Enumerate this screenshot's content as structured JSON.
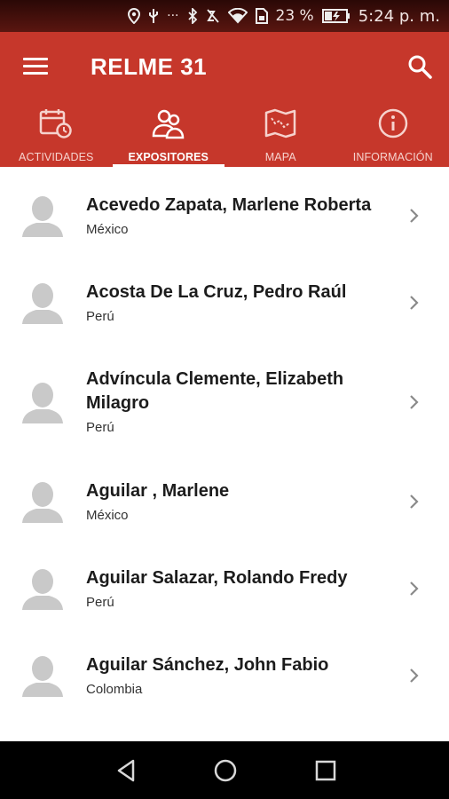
{
  "status_bar": {
    "icons": [
      "location-icon",
      "usb-icon",
      "more-icon",
      "bluetooth-icon",
      "mute-icon",
      "wifi-icon",
      "sim-icon",
      "battery-icon"
    ],
    "ellipsis": "···",
    "battery_percent": "23 %",
    "time": "5:24 p. m."
  },
  "app_bar": {
    "title": "RELME 31",
    "color": "#c6372b"
  },
  "tabs": [
    {
      "label": "ACTIVIDADES",
      "icon": "calendar-clock-icon",
      "active": false
    },
    {
      "label": "EXPOSITORES",
      "icon": "people-icon",
      "active": true
    },
    {
      "label": "MAPA",
      "icon": "map-icon",
      "active": false
    },
    {
      "label": "INFORMACIÓN",
      "icon": "info-icon",
      "active": false
    }
  ],
  "speakers": [
    {
      "name_line1": "Acevedo Zapata, Marlene Roberta",
      "name_line2": "",
      "country": "México"
    },
    {
      "name_line1": "Acosta De La Cruz, Pedro Raúl",
      "name_line2": "",
      "country": "Perú"
    },
    {
      "name_line1": "Advíncula Clemente, Elizabeth",
      "name_line2": "Milagro",
      "country": "Perú"
    },
    {
      "name_line1": "Aguilar , Marlene",
      "name_line2": "",
      "country": "México"
    },
    {
      "name_line1": "Aguilar Salazar, Rolando Fredy",
      "name_line2": "",
      "country": "Perú"
    },
    {
      "name_line1": "Aguilar Sánchez, John Fabio",
      "name_line2": "",
      "country": "Colombia"
    }
  ],
  "nav_bar": {
    "buttons": [
      "back-icon",
      "home-icon",
      "recents-icon"
    ]
  }
}
